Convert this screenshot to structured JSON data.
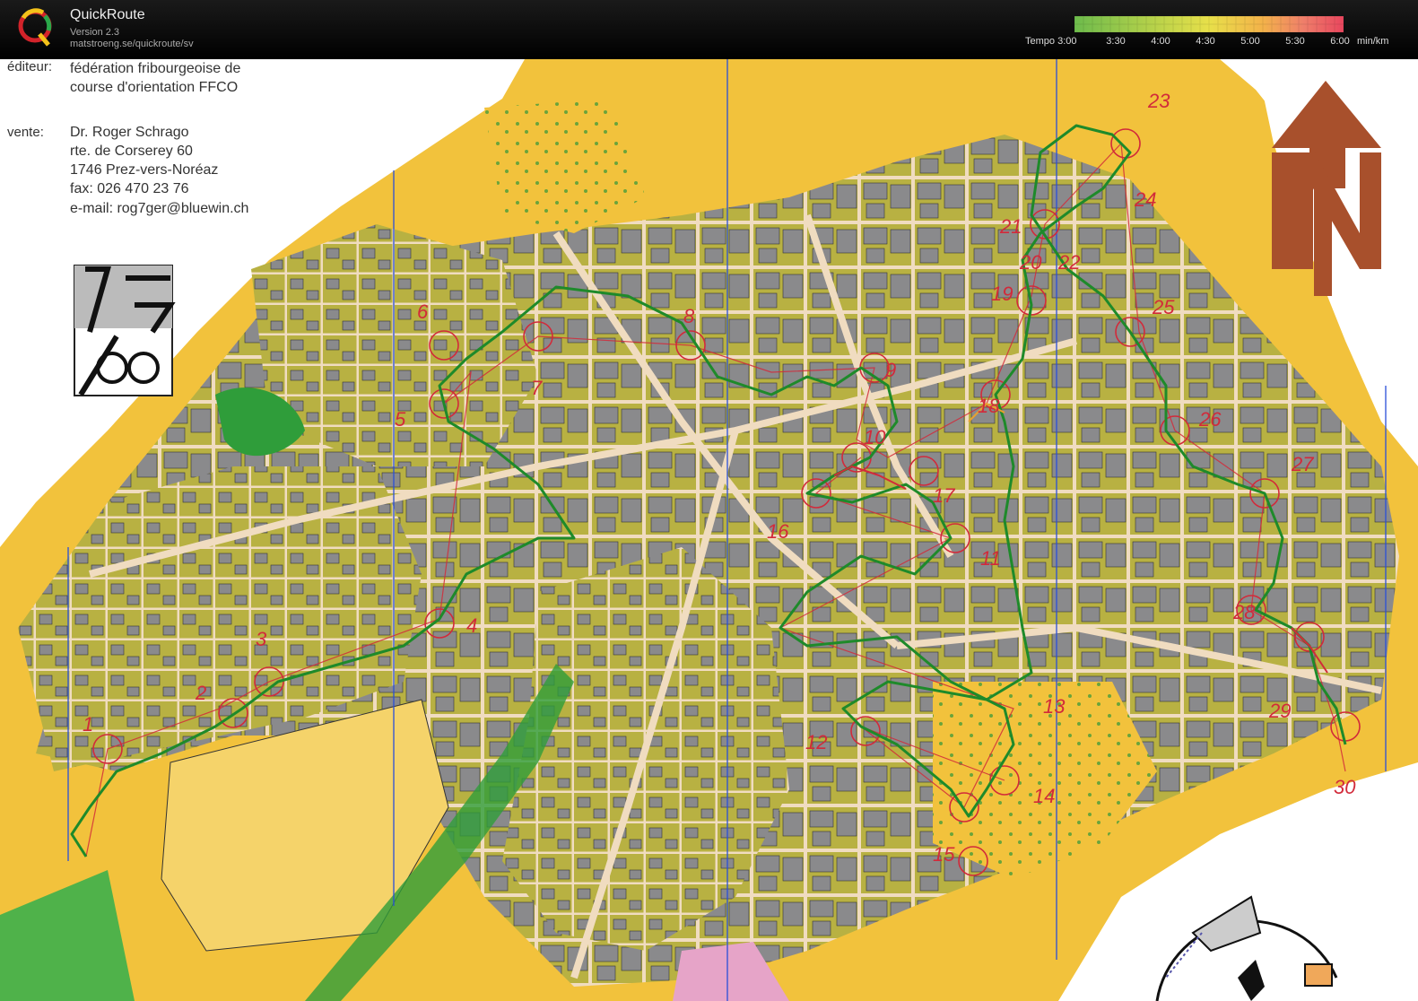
{
  "app": {
    "title": "QuickRoute",
    "version": "Version 2.3",
    "url": "matstroeng.se/quickroute/sv"
  },
  "tempo": {
    "label": "Tempo 3:00",
    "ticks": [
      "3:30",
      "4:00",
      "4:30",
      "5:00",
      "5:30",
      "6:00"
    ],
    "unit": "min/km",
    "colors": [
      "#6dbb4c",
      "#a6cf4a",
      "#e8e04a",
      "#f3b24a",
      "#ef6f5a",
      "#e8465e"
    ]
  },
  "map_info": {
    "editor_label": "éditeur:",
    "editor_line1": "fédération fribourgeoise de",
    "editor_line2": "course d'orientation FFCO",
    "sale_label": "vente:",
    "sale_line1": "Dr. Roger Schrago",
    "sale_line2": "rte. de Corserey 60",
    "sale_line3": "1746 Prez-vers-Noréaz",
    "sale_line4": "fax: 026 470 23 76",
    "sale_line5": "e-mail: rog7ger@bluewin.ch"
  },
  "controls": [
    "1",
    "2",
    "3",
    "4",
    "5",
    "6",
    "7",
    "8",
    "9",
    "10",
    "11",
    "12",
    "13",
    "14",
    "15",
    "16",
    "17",
    "18",
    "19",
    "20",
    "21",
    "22",
    "23",
    "24",
    "25",
    "26",
    "27",
    "28",
    "29",
    "30"
  ],
  "colors": {
    "open_land": "#f2c23c",
    "rough": "#b8b142",
    "building": "#8a8a8c",
    "paved": "#f0dcc0",
    "route": "#1e8a2a",
    "course": "#d22a3a",
    "north": "#a8502c"
  }
}
